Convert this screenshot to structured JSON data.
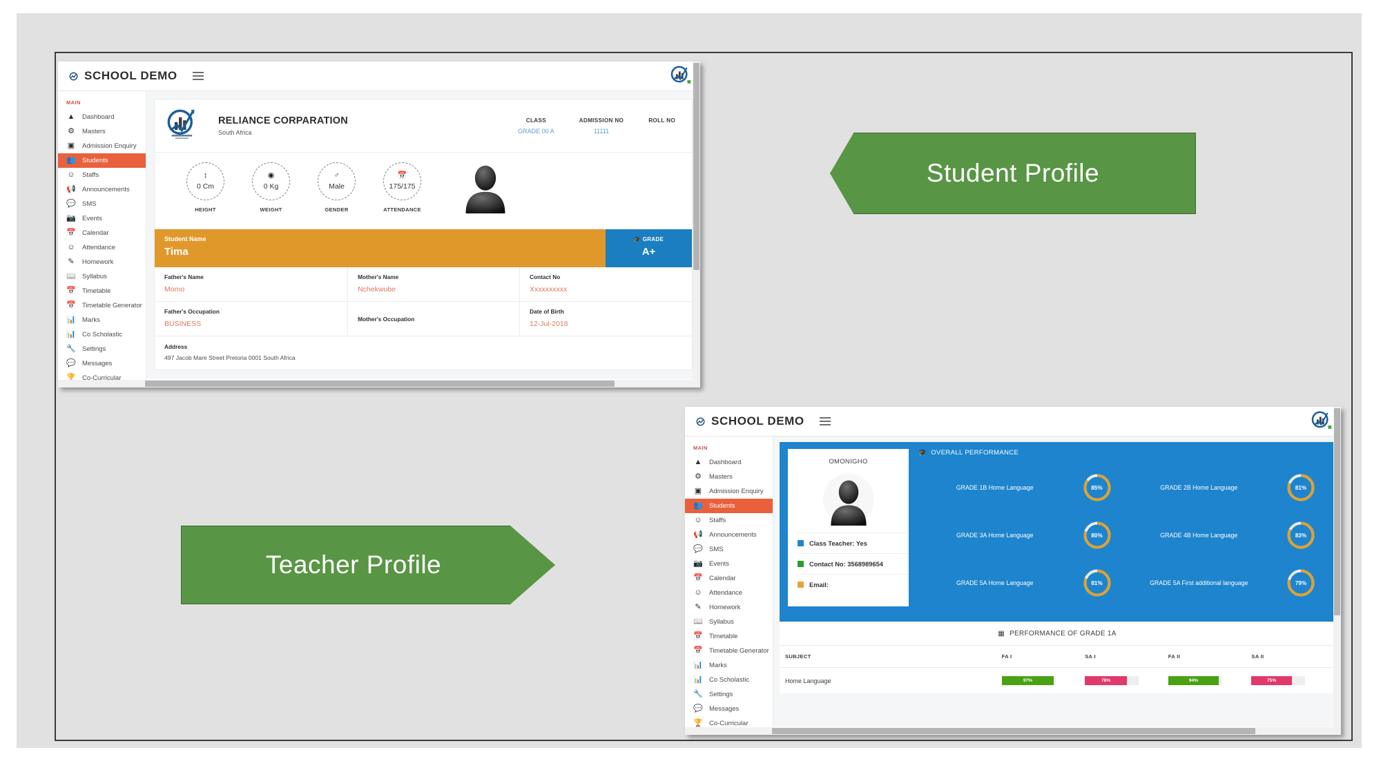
{
  "slide": {
    "banners": [
      {
        "label": "Student Profile",
        "direction": "left",
        "color": "#589544"
      },
      {
        "label": "Teacher Profile",
        "direction": "right",
        "color": "#589544"
      }
    ]
  },
  "app": {
    "brand": "SCHOOL DEMO",
    "menu_icon": "hamburger-icon",
    "logo_icon": "reliance-logo-icon"
  },
  "sidebar": {
    "section_label": "MAIN",
    "active": "Students",
    "items": [
      {
        "label": "Dashboard",
        "icon": "dashboard-icon"
      },
      {
        "label": "Masters",
        "icon": "gears-icon"
      },
      {
        "label": "Admission Enquiry",
        "icon": "id-card-icon"
      },
      {
        "label": "Students",
        "icon": "students-icon"
      },
      {
        "label": "Staffs",
        "icon": "user-icon"
      },
      {
        "label": "Announcements",
        "icon": "megaphone-icon"
      },
      {
        "label": "SMS",
        "icon": "chat-icon"
      },
      {
        "label": "Events",
        "icon": "camera-icon"
      },
      {
        "label": "Calendar",
        "icon": "calendar-icon"
      },
      {
        "label": "Attendance",
        "icon": "user-icon"
      },
      {
        "label": "Homework",
        "icon": "pencil-square-icon"
      },
      {
        "label": "Syllabus",
        "icon": "book-icon"
      },
      {
        "label": "Timetable",
        "icon": "calendar-icon"
      },
      {
        "label": "Timetable Generator",
        "icon": "calendar-icon"
      },
      {
        "label": "Marks",
        "icon": "bar-chart-icon"
      },
      {
        "label": "Co Scholastic",
        "icon": "bar-chart-icon"
      },
      {
        "label": "Settings",
        "icon": "wrench-icon"
      },
      {
        "label": "Messages",
        "icon": "chat-icon"
      },
      {
        "label": "Co-Curricular",
        "icon": "trophy-icon"
      }
    ]
  },
  "student": {
    "org_name": "RELIANCE CORPARATION",
    "org_location": "South Africa",
    "meta": [
      {
        "key": "CLASS",
        "value": "GRADE 00 A"
      },
      {
        "key": "ADMISSION NO",
        "value": "11111"
      },
      {
        "key": "ROLL NO",
        "value": ""
      }
    ],
    "stats": [
      {
        "caption": "HEIGHT",
        "value": "0 Cm",
        "icon": "height-arrow-icon"
      },
      {
        "caption": "WEIGHT",
        "value": "0 Kg",
        "icon": "weight-icon"
      },
      {
        "caption": "GENDER",
        "value": "Male",
        "icon": "person-icon"
      },
      {
        "caption": "ATTENDANCE",
        "value": "175/175",
        "icon": "calendar-icon"
      }
    ],
    "name_label": "Student Name",
    "name_value": "Tima",
    "grade_label": "GRADE",
    "grade_value": "A+",
    "fields": [
      {
        "key": "Father's Name",
        "value": "Momo"
      },
      {
        "key": "Mother's Name",
        "value": "Nchekwube"
      },
      {
        "key": "Contact No",
        "value": "Xxxxxxxxxx"
      },
      {
        "key": "Father's Occupation",
        "value": "BUSINESS"
      },
      {
        "key": "Mother's Occupation",
        "value": ""
      },
      {
        "key": "Date of Birth",
        "value": "12-Jul-2018"
      }
    ],
    "address_label": "Address",
    "address_value": "497 Jacob Mare Street Pretoria 0001 South Africa",
    "colors": {
      "name_bar": "#e0982b",
      "grade_bar": "#1a7ec0",
      "value_text": "#e0775c",
      "meta_value": "#5b9bd5"
    }
  },
  "teacher": {
    "name": "OMONIGHO",
    "photo_icon": "avatar-icon",
    "meta": [
      {
        "label": "Class Teacher: Yes",
        "color": "#1d84cd"
      },
      {
        "label": "Contact No: 3568989654",
        "color": "#2e9b2e"
      },
      {
        "label": "Email:",
        "color": "#e8a33d"
      }
    ],
    "performance_title": "OVERALL PERFORMANCE",
    "performance_icon": "graduation-cap-icon",
    "performance": [
      {
        "label": "GRADE 1B Home Language",
        "value": 85,
        "display": "85%"
      },
      {
        "label": "GRADE 2B Home Language",
        "value": 81,
        "display": "81%"
      },
      {
        "label": "GRADE 3A Home Language",
        "value": 80,
        "display": "80%"
      },
      {
        "label": "GRADE 4B Home Language",
        "value": 83,
        "display": "83%"
      },
      {
        "label": "GRADE 5A Home Language",
        "value": 81,
        "display": "81%"
      },
      {
        "label": "GRADE 5A First additional language",
        "value": 79,
        "display": "79%"
      }
    ],
    "table": {
      "title": "PERFORMANCE OF GRADE 1A",
      "title_icon": "table-icon",
      "columns": [
        "SUBJECT",
        "FA I",
        "SA I",
        "FA II",
        "SA II"
      ],
      "rows": [
        {
          "subject": "Home Language",
          "cells": [
            {
              "value": 97,
              "display": "97%",
              "color": "#4ba114"
            },
            {
              "value": 78,
              "display": "78%",
              "color": "#e0396b"
            },
            {
              "value": 94,
              "display": "94%",
              "color": "#4ba114"
            },
            {
              "value": 75,
              "display": "75%",
              "color": "#e0396b"
            }
          ]
        }
      ]
    },
    "panel_color": "#1d84cd",
    "ring_color": "#e0a02c"
  }
}
